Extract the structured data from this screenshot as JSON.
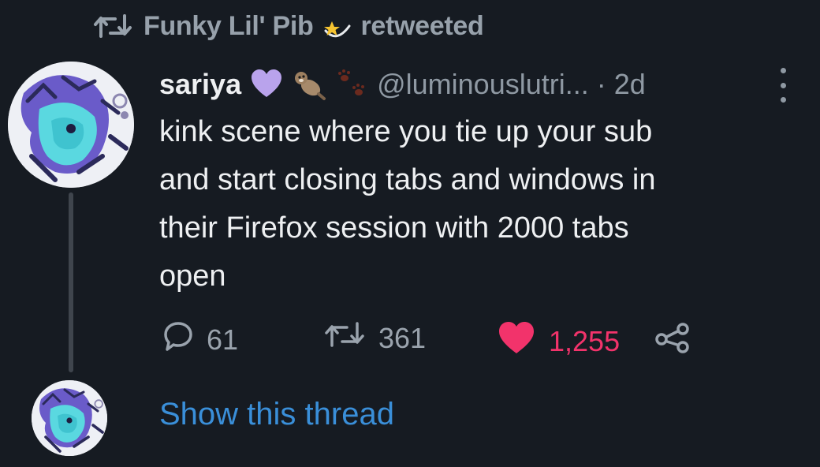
{
  "retweet": {
    "icon": "retweet-icon",
    "retweeter": "Funky Lil' Pib",
    "retweeter_emoji": "shooting-star-emoji",
    "suffix": "retweeted"
  },
  "tweet": {
    "display_name": "sariya",
    "name_emojis": [
      "purple-heart-emoji",
      "otter-emoji",
      "paw-prints-emoji"
    ],
    "handle": "@luminouslutri...",
    "time": "· 2d",
    "text": "kink scene where you tie up your sub\nand start closing tabs and windows in\ntheir Firefox session with 2000 tabs\nopen",
    "replies": "61",
    "retweets": "361",
    "likes": "1,255",
    "liked": true
  },
  "thread": {
    "show_label": "Show this thread"
  },
  "colors": {
    "background": "#161b22",
    "accent_link": "#3a8fd9",
    "like": "#f2336b",
    "muted": "#8f99a3"
  }
}
